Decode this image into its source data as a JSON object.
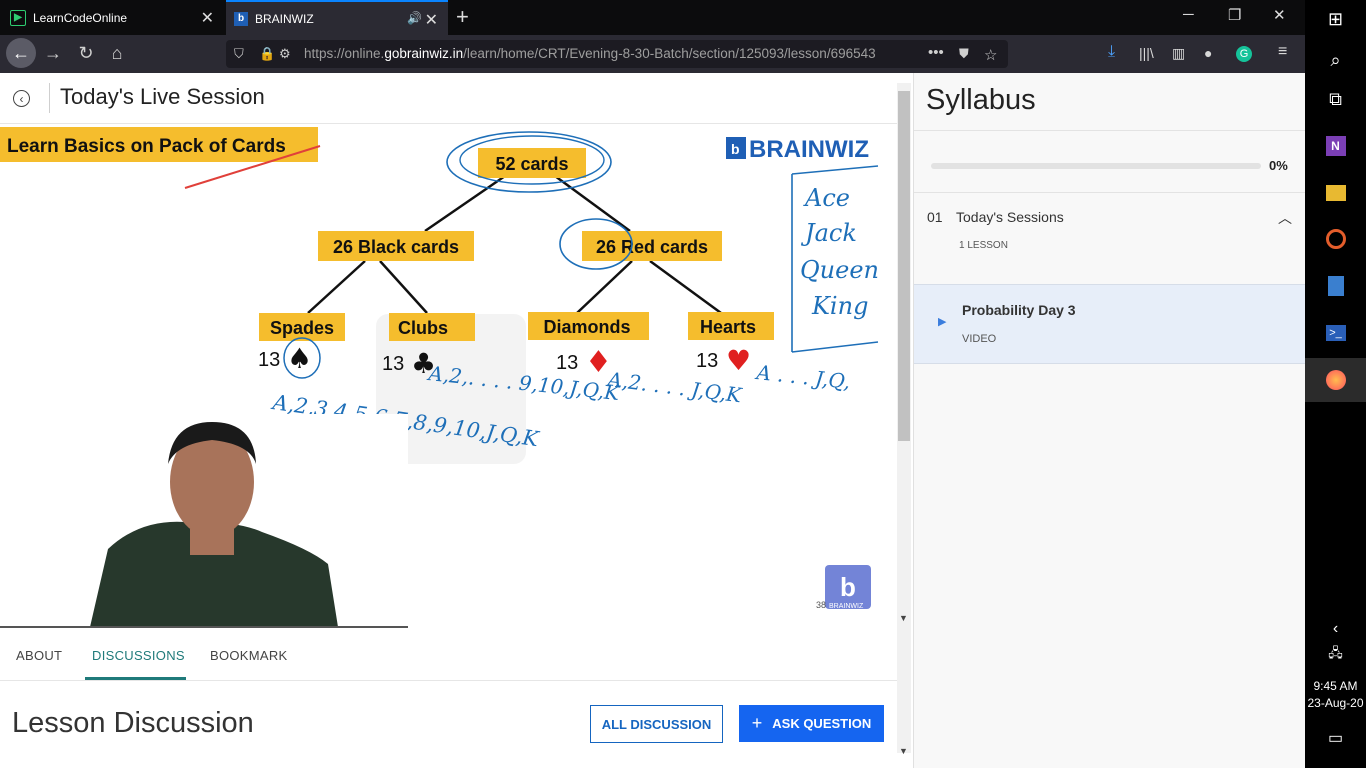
{
  "browser": {
    "tabs": [
      {
        "label": "LearnCodeOnline",
        "active": false
      },
      {
        "label": "BRAINWIZ",
        "active": true
      }
    ],
    "url_prefix": "https://online.",
    "url_host": "gobrainwiz.in",
    "url_path": "/learn/home/CRT/Evening-8-30-Batch/section/125093/lesson/696543",
    "accent": "#0a84ff"
  },
  "page": {
    "title": "Today's Live Session",
    "tabs": [
      "ABOUT",
      "DISCUSSIONS",
      "BOOKMARK"
    ],
    "active_tab": "DISCUSSIONS",
    "discussion_heading": "Lesson Discussion",
    "all_discussion_label": "ALL DISCUSSION",
    "ask_question_label": "ASK QUESTION",
    "ask_question_icon": "+"
  },
  "video": {
    "banner": "Learn Basics on  Pack of Cards",
    "brand": "BRAINWIZ",
    "root_node": "52 cards",
    "black_node": "26 Black cards",
    "red_node": "26 Red cards",
    "suits": [
      {
        "name": "Spades",
        "count": "13",
        "symbol": "♠"
      },
      {
        "name": "Clubs",
        "count": "13",
        "symbol": "♣"
      },
      {
        "name": "Diamonds",
        "count": "13",
        "symbol": "♦"
      },
      {
        "name": "Hearts",
        "count": "13",
        "symbol": "♥"
      }
    ],
    "handwriting": {
      "face_cards": [
        "Ace",
        "Jack",
        "Queen",
        "King"
      ],
      "seq1": "A,2,3,4,5,6,7,8,9,10,J,Q,K",
      "seq2": "A,2,. . . . 9,10,J,Q,K",
      "seq3": "A,2. . . . J,Q,K",
      "seq4": "A . . . J,Q,"
    },
    "watermark_number": "38",
    "watermark_brand": "BRAINWIZ"
  },
  "syllabus": {
    "title": "Syllabus",
    "progress_percent": 0,
    "progress_label": "0%",
    "section_number": "01",
    "section_title": "Today's Sessions",
    "section_count": "1 LESSON",
    "lesson_name": "Probability Day 3",
    "lesson_type": "VIDEO"
  },
  "taskbar": {
    "time": "9:45 AM",
    "date": "23-Aug-20"
  }
}
